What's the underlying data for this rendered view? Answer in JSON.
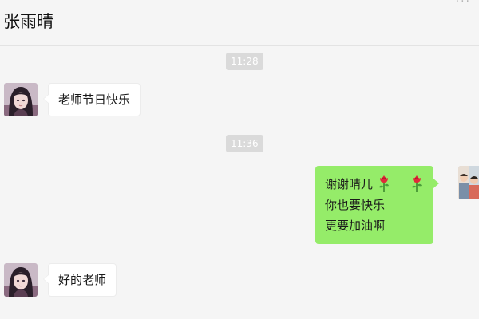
{
  "header": {
    "title": "张雨晴"
  },
  "messages": [
    {
      "type": "timestamp",
      "text": "11:28"
    },
    {
      "type": "incoming",
      "text": "老师节日快乐"
    },
    {
      "type": "timestamp",
      "text": "11:36"
    },
    {
      "type": "outgoing",
      "lines": [
        "谢谢晴儿",
        "你也要快乐",
        "更要加油啊"
      ],
      "emoji": [
        "rose-emoji",
        "rose-emoji"
      ]
    },
    {
      "type": "incoming",
      "text": "好的老师"
    }
  ],
  "colors": {
    "background": "#f5f5f5",
    "incoming_bubble": "#ffffff",
    "outgoing_bubble": "#95ec69",
    "timestamp_bg": "#dadada",
    "timestamp_text": "#ffffff"
  },
  "icons": {
    "contact_avatar": "girl-portrait-avatar",
    "self_avatar": "group-photo-avatar",
    "emoji": "rose-emoji"
  }
}
